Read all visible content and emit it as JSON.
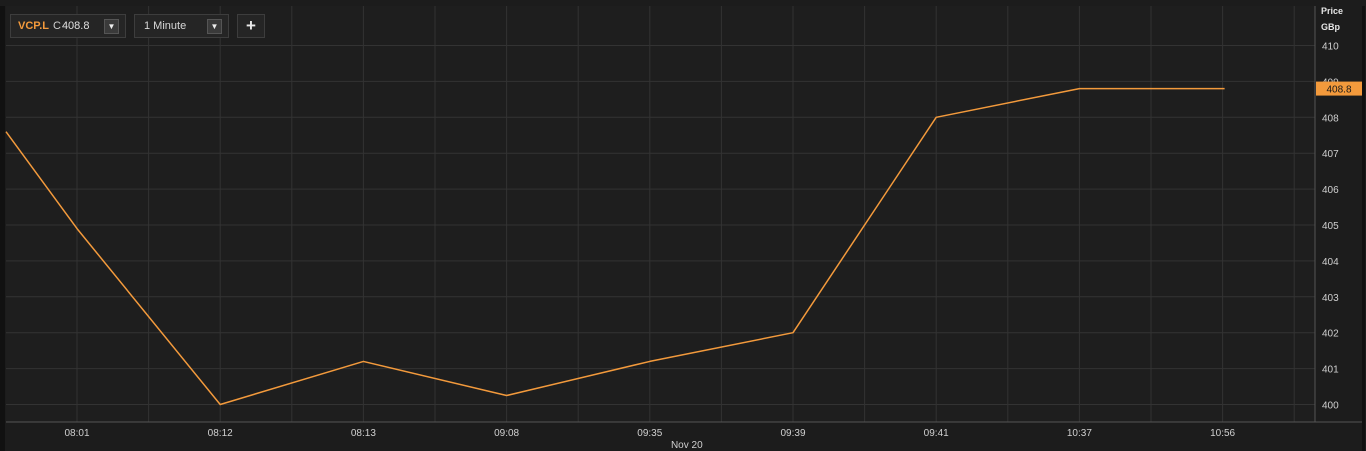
{
  "toolbar": {
    "symbol": "VCP.L",
    "close_label": "C",
    "close_value": "408.8",
    "interval": "1 Minute",
    "dropdown_icon": "caret-down-icon",
    "add_icon": "plus-icon",
    "add_label": "+"
  },
  "axis": {
    "price_label": "Price",
    "currency_label": "GBp",
    "date_label": "Nov 20"
  },
  "colors": {
    "series": "#f39a3c",
    "background": "#1c1c1c",
    "grid": "#333333",
    "axis_text": "#d0d0d0"
  },
  "chart_data": {
    "type": "line",
    "title": "",
    "xlabel": "Nov 20",
    "ylabel": "Price GBp",
    "x": [
      "08:01",
      "08:12",
      "08:13",
      "09:08",
      "09:35",
      "09:39",
      "09:41",
      "10:37",
      "10:56"
    ],
    "series": [
      {
        "values": [
          404.9,
          400.0,
          401.2,
          400.25,
          401.2,
          402.0,
          408.0,
          408.8,
          408.8
        ]
      }
    ],
    "line_start_y": 407.6,
    "ylim": [
      399.6,
      411.2
    ],
    "yticks": [
      400,
      401,
      402,
      403,
      404,
      405,
      406,
      407,
      408,
      409,
      410
    ],
    "last_price": "408.8",
    "grid": true
  }
}
